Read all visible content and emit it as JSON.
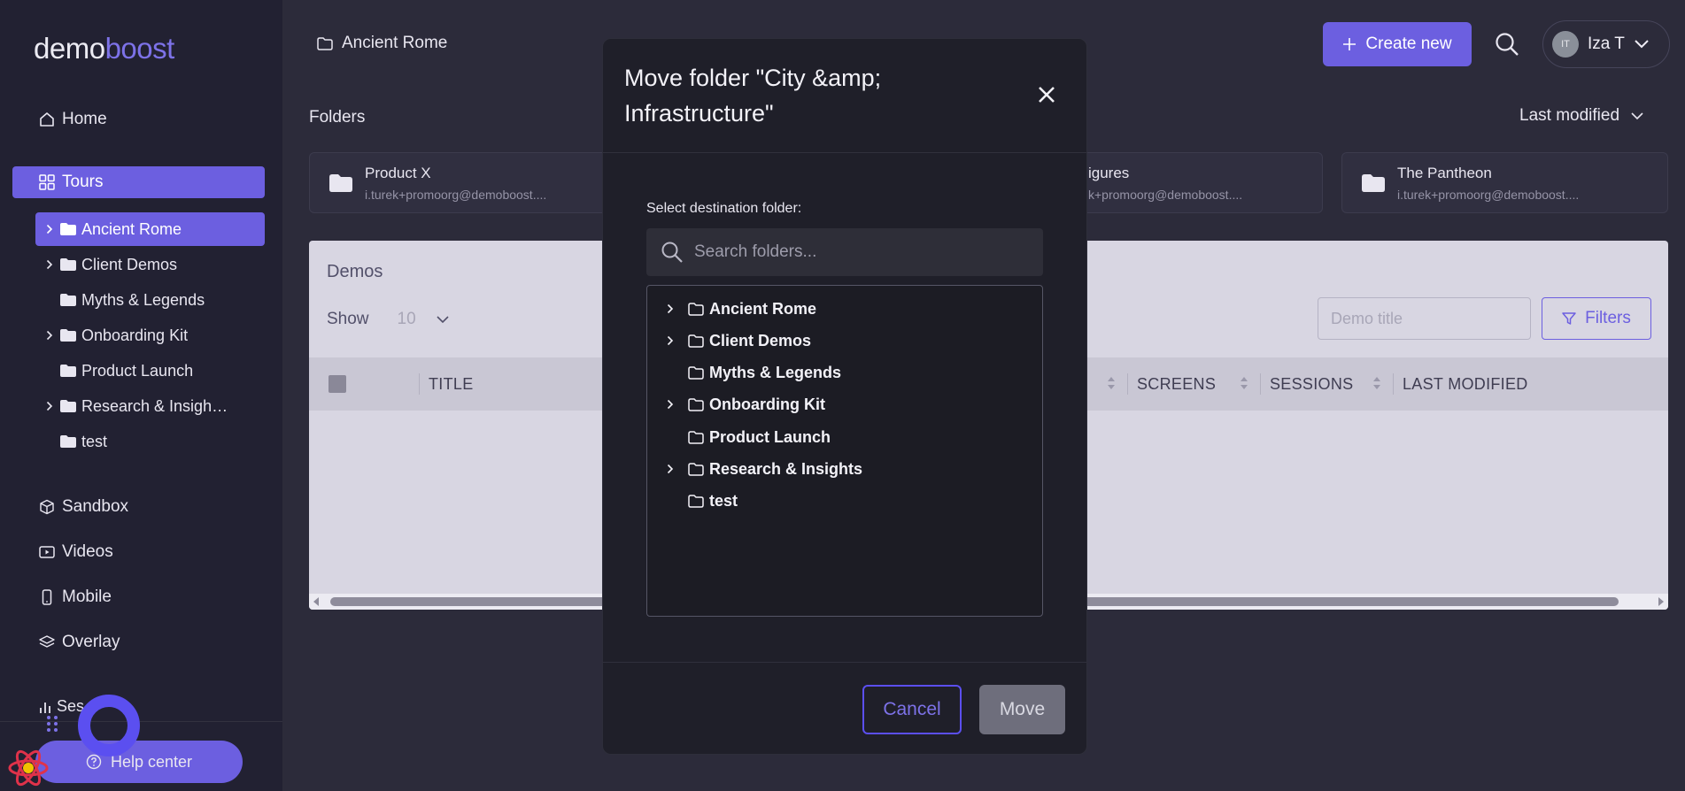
{
  "colors": {
    "accent": "#6c5fe0",
    "sidebar_bg": "#222132",
    "main_bg": "#2c2b3a",
    "modal_bg": "#1f1f29"
  },
  "sidebar": {
    "logo_part1": "demo",
    "logo_part2": "boost",
    "home": "Home",
    "tours": "Tours",
    "tree": [
      "Ancient Rome",
      "Client Demos",
      "Myths & Legends",
      "Onboarding Kit",
      "Product Launch",
      "Research & Insigh…",
      "test"
    ],
    "sandbox": "Sandbox",
    "videos": "Videos",
    "mobile": "Mobile",
    "overlay": "Overlay",
    "sessions": "Ses",
    "help": "Help center"
  },
  "header": {
    "breadcrumb": "Ancient Rome",
    "create": "Create new",
    "user_initials": "IT",
    "user_name": "Iza T"
  },
  "folders": {
    "title": "Folders",
    "sort": "Last modified",
    "cards": [
      {
        "name": "Product X",
        "owner": "i.turek+promoorg@demoboost...."
      },
      {
        "name": "igures",
        "owner": "k+promoorg@demoboost...."
      },
      {
        "name": "The Pantheon",
        "owner": "i.turek+promoorg@demoboost...."
      }
    ]
  },
  "demos": {
    "title": "Demos",
    "show_label": "Show",
    "show_value": "10",
    "search_placeholder": "Demo title",
    "filters": "Filters",
    "columns": {
      "title": "TITLE",
      "screens": "SCREENS",
      "sessions": "SESSIONS",
      "last_modified": "LAST MODIFIED"
    }
  },
  "modal": {
    "title": "Move folder \"City &amp; Infrastructure\"",
    "label": "Select destination folder:",
    "search_placeholder": "Search folders...",
    "tree": [
      {
        "label": "Ancient Rome",
        "expandable": true
      },
      {
        "label": "Client Demos",
        "expandable": true
      },
      {
        "label": "Myths & Legends",
        "expandable": false
      },
      {
        "label": "Onboarding Kit",
        "expandable": true
      },
      {
        "label": "Product Launch",
        "expandable": false
      },
      {
        "label": "Research & Insights",
        "expandable": true
      },
      {
        "label": "test",
        "expandable": false
      }
    ],
    "cancel": "Cancel",
    "move": "Move"
  }
}
